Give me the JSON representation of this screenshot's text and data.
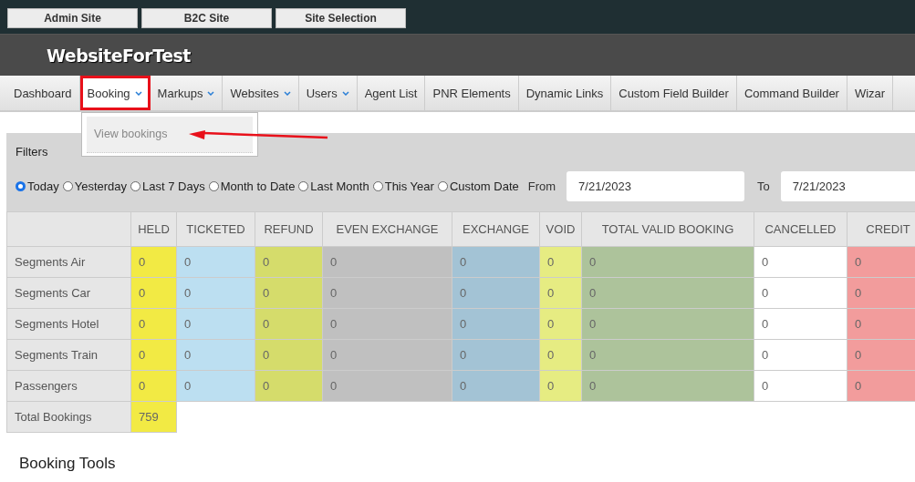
{
  "site_buttons": [
    "Admin Site",
    "B2C Site",
    "Site Selection"
  ],
  "header": {
    "title": "WebsiteForTest"
  },
  "nav": [
    {
      "label": "Dashboard",
      "dropdown": false,
      "selected": false,
      "outlined": false
    },
    {
      "label": "Booking",
      "dropdown": true,
      "selected": true,
      "outlined": true
    },
    {
      "label": "Markups",
      "dropdown": true,
      "selected": false,
      "outlined": false
    },
    {
      "label": "Websites",
      "dropdown": true,
      "selected": false,
      "outlined": false
    },
    {
      "label": "Users",
      "dropdown": true,
      "selected": false,
      "outlined": false
    },
    {
      "label": "Agent List",
      "dropdown": false,
      "selected": false,
      "outlined": false
    },
    {
      "label": "PNR Elements",
      "dropdown": false,
      "selected": false,
      "outlined": false
    },
    {
      "label": "Dynamic Links",
      "dropdown": false,
      "selected": false,
      "outlined": false
    },
    {
      "label": "Custom Field Builder",
      "dropdown": false,
      "selected": false,
      "outlined": false
    },
    {
      "label": "Command Builder",
      "dropdown": false,
      "selected": false,
      "outlined": false
    },
    {
      "label": "Wizar",
      "dropdown": false,
      "selected": false,
      "outlined": false
    }
  ],
  "dropdown_menu": {
    "items": [
      "View bookings"
    ],
    "arrow": true
  },
  "filters": {
    "title": "Filters",
    "options": [
      {
        "label": "Today",
        "selected": true
      },
      {
        "label": "Yesterday",
        "selected": false
      },
      {
        "label": "Last 7 Days",
        "selected": false
      },
      {
        "label": "Month to Date",
        "selected": false
      },
      {
        "label": "Last Month",
        "selected": false
      },
      {
        "label": "This Year",
        "selected": false
      },
      {
        "label": "Custom Date",
        "selected": false
      }
    ],
    "from_label": "From",
    "from_value": "7/21/2023",
    "to_label": "To",
    "to_value": "7/21/2023"
  },
  "table": {
    "columns": [
      {
        "label": "HELD",
        "color": "#f2ea44"
      },
      {
        "label": "TICKETED",
        "color": "#bcdff1"
      },
      {
        "label": "REFUND",
        "color": "#d5dc6b"
      },
      {
        "label": "EVEN EXCHANGE",
        "color": "#c0c0c0"
      },
      {
        "label": "EXCHANGE",
        "color": "#a3c3d5"
      },
      {
        "label": "VOID",
        "color": "#e6ec82"
      },
      {
        "label": "TOTAL VALID BOOKING",
        "color": "#adc39b"
      },
      {
        "label": "CANCELLED",
        "color": "#ffffff"
      },
      {
        "label": "CREDIT",
        "color": "#f29c9c"
      }
    ],
    "rows": [
      {
        "label": "Segments Air",
        "values": [
          "0",
          "0",
          "0",
          "0",
          "0",
          "0",
          "0",
          "0",
          "0"
        ]
      },
      {
        "label": "Segments Car",
        "values": [
          "0",
          "0",
          "0",
          "0",
          "0",
          "0",
          "0",
          "0",
          "0"
        ]
      },
      {
        "label": "Segments Hotel",
        "values": [
          "0",
          "0",
          "0",
          "0",
          "0",
          "0",
          "0",
          "0",
          "0"
        ]
      },
      {
        "label": "Segments Train",
        "values": [
          "0",
          "0",
          "0",
          "0",
          "0",
          "0",
          "0",
          "0",
          "0"
        ]
      },
      {
        "label": "Passengers",
        "values": [
          "0",
          "0",
          "0",
          "0",
          "0",
          "0",
          "0",
          "0",
          "0"
        ]
      },
      {
        "label": "Total Bookings",
        "values": [
          "759"
        ]
      }
    ]
  },
  "section_title": "Booking Tools"
}
